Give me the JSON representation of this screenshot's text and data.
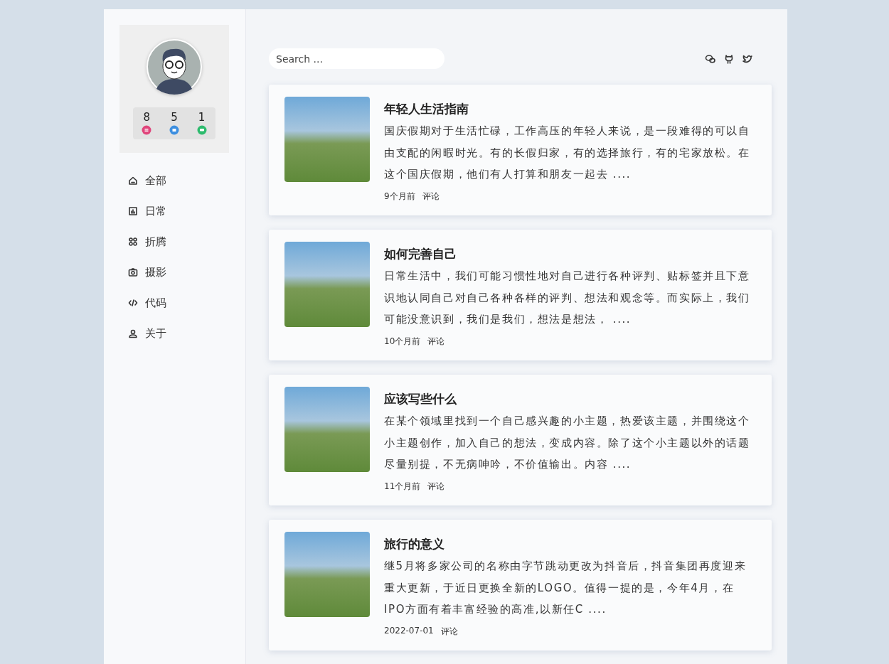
{
  "profile": {
    "stats": [
      {
        "count": "8",
        "color": "#e0457b",
        "kind": "list"
      },
      {
        "count": "5",
        "color": "#3d8fe0",
        "kind": "folder"
      },
      {
        "count": "1",
        "color": "#2dbb6d",
        "kind": "chat"
      }
    ]
  },
  "nav": [
    {
      "label": "全部",
      "kind": "home"
    },
    {
      "label": "日常",
      "kind": "chart"
    },
    {
      "label": "折腾",
      "kind": "grid"
    },
    {
      "label": "摄影",
      "kind": "camera"
    },
    {
      "label": "代码",
      "kind": "code"
    },
    {
      "label": "关于",
      "kind": "user"
    }
  ],
  "search": {
    "placeholder": "Search ..."
  },
  "social": [
    {
      "kind": "wechat"
    },
    {
      "kind": "github"
    },
    {
      "kind": "twitter"
    }
  ],
  "posts": [
    {
      "title": "年轻人生活指南",
      "excerpt": "国庆假期对于生活忙碌，工作高压的年轻人来说，是一段难得的可以自由支配的闲暇时光。有的长假归家，有的选择旅行，有的宅家放松。在这个国庆假期，他们有人打算和朋友一起去 ....",
      "date": "9个月前",
      "comments": "评论"
    },
    {
      "title": "如何完善自己",
      "excerpt": "日常生活中，我们可能习惯性地对自己进行各种评判、贴标签并且下意识地认同自己对自己各种各样的评判、想法和观念等。而实际上，我们可能没意识到，我们是我们，想法是想法， ....",
      "date": "10个月前",
      "comments": "评论"
    },
    {
      "title": "应该写些什么",
      "excerpt": "在某个领域里找到一个自己感兴趣的小主题，热爱该主题，并围绕这个小主题创作，加入自己的想法，变成内容。除了这个小主题以外的话题尽量别提，不无病呻吟，不价值输出。内容 ....",
      "date": "11个月前",
      "comments": "评论"
    },
    {
      "title": "旅行的意义",
      "excerpt": "继5月将多家公司的名称由字节跳动更改为抖音后，抖音集团再度迎来重大更新，于近日更换全新的LOGO。值得一提的是，今年4月，在IPO方面有着丰富经验的高准,以新任C ....",
      "date": "2022-07-01",
      "comments": "评论"
    }
  ]
}
